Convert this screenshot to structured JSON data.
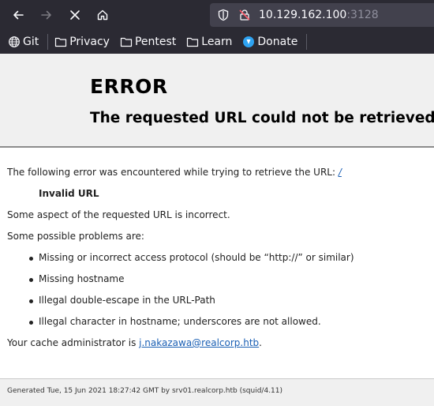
{
  "browser": {
    "url_host": "10.129.162.100",
    "url_port": ":3128",
    "bookmarks": [
      {
        "label": "Git",
        "icon": "globe-icon"
      },
      {
        "label": "Privacy",
        "icon": "folder-icon"
      },
      {
        "label": "Pentest",
        "icon": "folder-icon"
      },
      {
        "label": "Learn",
        "icon": "folder-icon"
      },
      {
        "label": "Donate",
        "icon": "donate-icon"
      }
    ]
  },
  "error": {
    "title": "ERROR",
    "subtitle": "The requested URL could not be retrieved",
    "intro": "The following error was encountered while trying to retrieve the URL: ",
    "intro_link": "/",
    "error_name": "Invalid URL",
    "description": "Some aspect of the requested URL is incorrect.",
    "problems_heading": "Some possible problems are:",
    "problems": [
      "Missing or incorrect access protocol (should be “http://” or similar)",
      "Missing hostname",
      "Illegal double-escape in the URL-Path",
      "Illegal character in hostname; underscores are not allowed."
    ],
    "admin_prefix": "Your cache administrator is ",
    "admin_email": "j.nakazawa@realcorp.htb",
    "admin_suffix": "."
  },
  "footer": {
    "text": "Generated Tue, 15 Jun 2021 18:27:42 GMT by srv01.realcorp.htb (squid/4.11)"
  }
}
